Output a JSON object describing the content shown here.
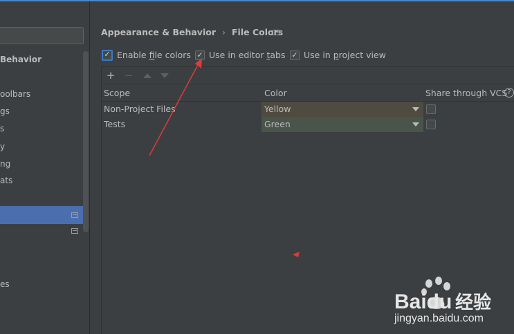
{
  "sidebar": {
    "items": [
      {
        "label": "Behavior",
        "bold": true
      },
      {
        "label": "oolbars"
      },
      {
        "label": "gs"
      },
      {
        "label": "s"
      },
      {
        "label": "y"
      },
      {
        "label": "ng"
      },
      {
        "label": "ats"
      },
      {
        "label": "es"
      }
    ]
  },
  "breadcrumb": {
    "parent": "Appearance & Behavior",
    "separator": "›",
    "current": "File Colors"
  },
  "options": {
    "enable_file_colors": {
      "prefix": "Enable ",
      "mnemonic": "f",
      "suffix": "ile colors",
      "checked": true
    },
    "use_in_editor_tabs": {
      "prefix": "Use in editor ",
      "mnemonic": "t",
      "suffix": "abs",
      "checked": true
    },
    "use_in_project_view": {
      "prefix": "Use in ",
      "mnemonic": "p",
      "suffix": "roject view",
      "checked": true
    }
  },
  "toolbar": {
    "add": "+",
    "remove": "−"
  },
  "table": {
    "headers": {
      "scope": "Scope",
      "color": "Color",
      "share": "Share through VCS",
      "help": "?"
    },
    "rows": [
      {
        "scope": "Non-Project Files",
        "color": "Yellow",
        "color_hex": "#4f4b41",
        "shared": false
      },
      {
        "scope": "Tests",
        "color": "Green",
        "color_hex": "#49544a",
        "shared": false
      }
    ]
  },
  "theme": {
    "background": "#3c3f41",
    "selection": "#4b6eaf",
    "annotation": "#e03a3a"
  },
  "watermark": {
    "brand": "Baidu",
    "brand_cn": "经验",
    "url": "jingyan.baidu.com"
  }
}
